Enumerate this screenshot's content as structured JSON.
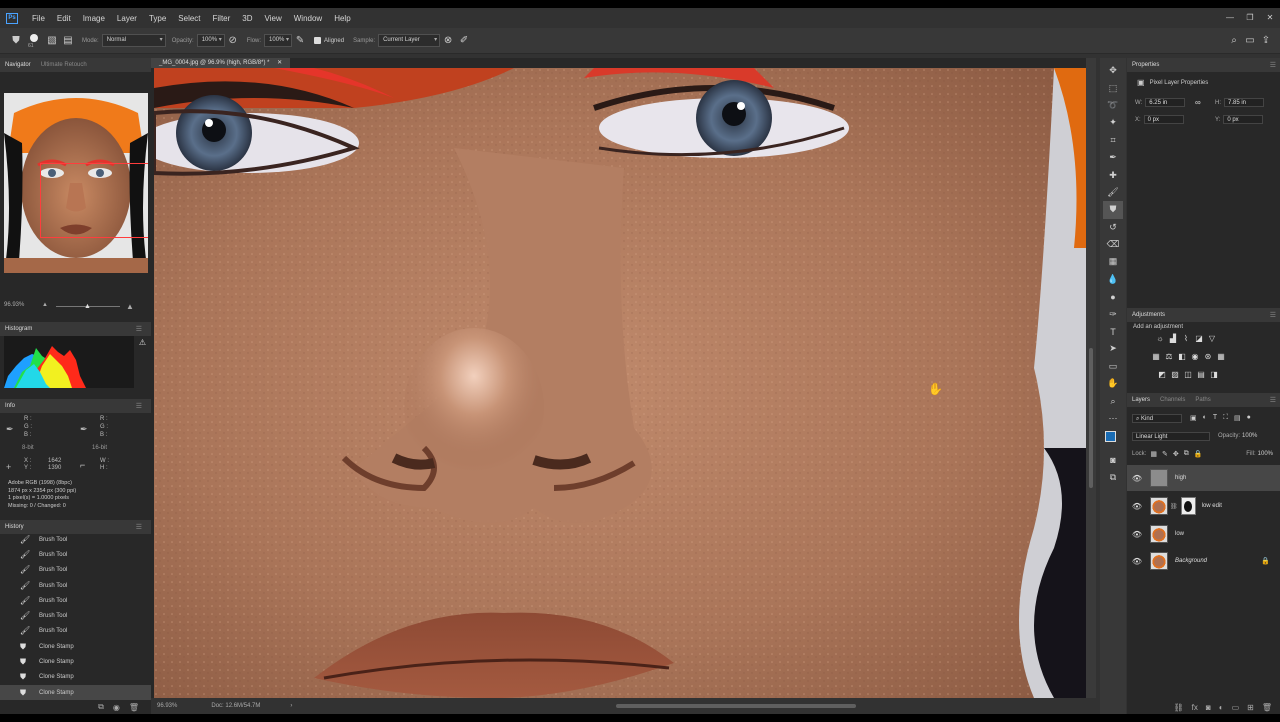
{
  "menubar": {
    "items": [
      "File",
      "Edit",
      "Image",
      "Layer",
      "Type",
      "Select",
      "Filter",
      "3D",
      "View",
      "Window",
      "Help"
    ],
    "logo": "Ps"
  },
  "options": {
    "brush_size": "61",
    "mode_label": "Mode:",
    "mode_value": "Normal",
    "opacity_label": "Opacity:",
    "opacity_value": "100%",
    "flow_label": "Flow:",
    "flow_value": "100%",
    "aligned_label": "Aligned",
    "sample_label": "Sample:",
    "sample_value": "Current Layer"
  },
  "navigator": {
    "tab_active": "Navigator",
    "tab_other": "Ultimate Retouch",
    "zoom": "96.93%"
  },
  "histogram": {
    "title": "Histogram"
  },
  "info": {
    "title": "Info",
    "r": "R :",
    "g": "G :",
    "b": "B :",
    "bit_left": "8-bit",
    "bit_right": "16-bit",
    "x_label": "X :",
    "y_label": "Y :",
    "x_value": "1642",
    "y_value": "1390",
    "w_label": "W :",
    "h_label": "H :",
    "line1": "Adobe RGB (1998) (8bpc)",
    "line2": "1874 px x 2354 px (300 ppi)",
    "line3": "1 pixel(s) = 1.0000 pixels",
    "line4": "Missing: 0 / Changed: 0"
  },
  "history": {
    "title": "History",
    "items": [
      "Brush Tool",
      "Brush Tool",
      "Brush Tool",
      "Brush Tool",
      "Brush Tool",
      "Brush Tool",
      "Brush Tool",
      "Clone Stamp",
      "Clone Stamp",
      "Clone Stamp",
      "Clone Stamp"
    ]
  },
  "document": {
    "tab_title": "_MG_0004.jpg @ 96.9% (high, RGB/8*) *",
    "zoom": "96.93%",
    "doc_size": "Doc: 12.6M/54.7M"
  },
  "properties": {
    "title": "Properties",
    "subtitle": "Pixel Layer Properties",
    "w_label": "W:",
    "w_value": "6.25 in",
    "h_label": "H:",
    "h_value": "7.85 in",
    "x_label": "X:",
    "x_value": "0 px",
    "y_label": "Y:",
    "y_value": "0 px"
  },
  "adjustments": {
    "title": "Adjustments",
    "subtitle": "Add an adjustment"
  },
  "layers": {
    "tabs": [
      "Layers",
      "Channels",
      "Paths"
    ],
    "filter": "Kind",
    "blend": "Linear Light",
    "opacity_label": "Opacity:",
    "opacity_value": "100%",
    "lock_label": "Lock:",
    "fill_label": "Fill:",
    "fill_value": "100%",
    "items": [
      "high",
      "low edit",
      "low",
      "Background"
    ]
  },
  "colors": {
    "accent": "#4aa3ff",
    "nav_rect": "#ff3d3d",
    "fg_swatch": "#1a6db5"
  }
}
